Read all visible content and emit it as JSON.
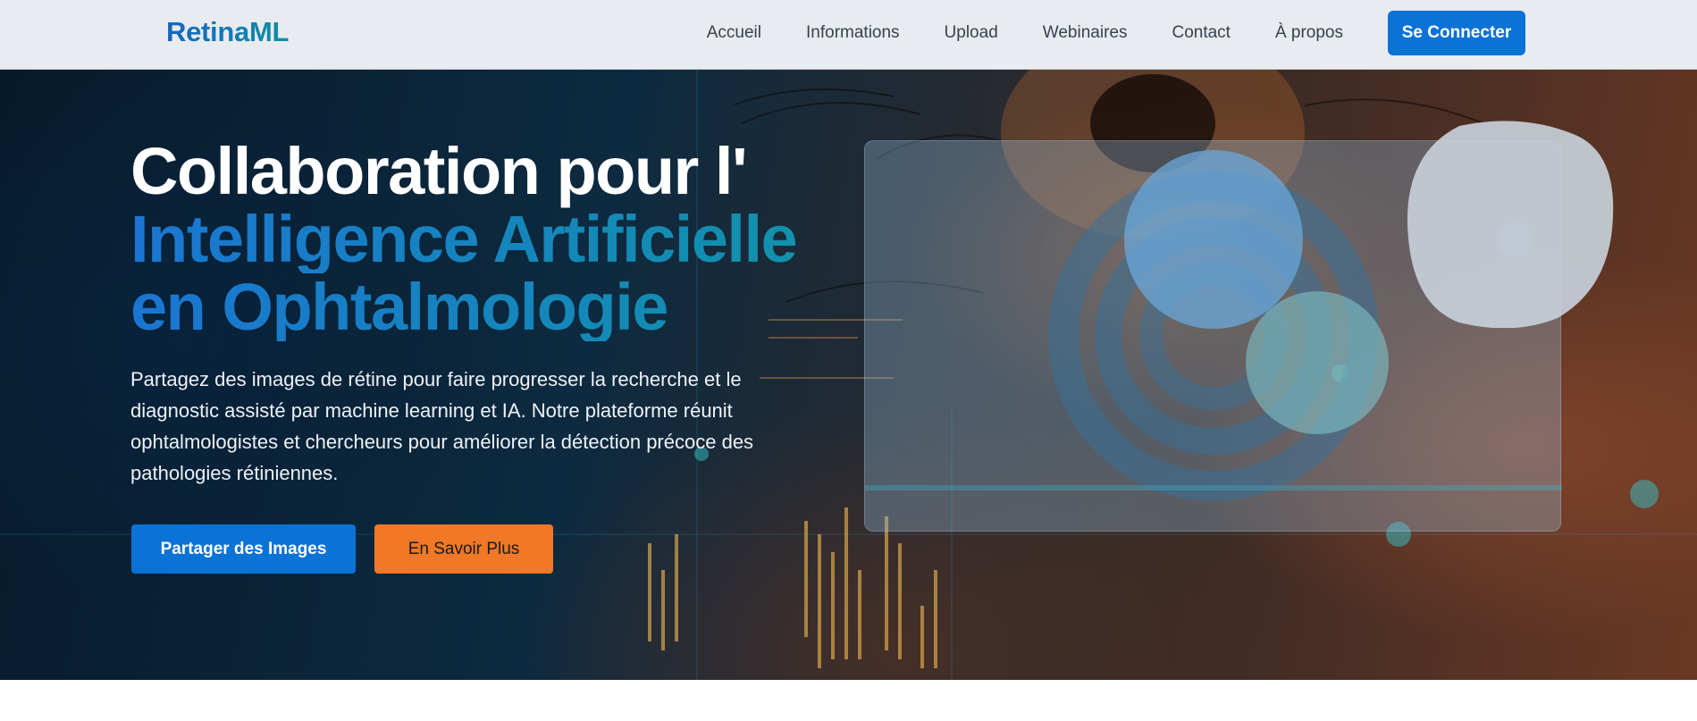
{
  "navbar": {
    "brand": "RetinaML",
    "links": [
      "Accueil",
      "Informations",
      "Upload",
      "Webinaires",
      "Contact",
      "À propos"
    ],
    "login_label": "Se Connecter"
  },
  "hero": {
    "title_line1": "Collaboration pour l'",
    "title_line2": "Intelligence Artificielle",
    "title_line3": "en Ophtalmologie",
    "description": "Partagez des images de rétine pour faire progresser la recherche et le diagnostic assisté par machine learning et IA. Notre plateforme réunit ophtalmologistes et chercheurs pour améliorer la détection précoce des pathologies rétiniennes.",
    "primary_button": "Partager des Images",
    "secondary_button": "En Savoir Plus"
  },
  "colors": {
    "primary": "#0b72d6",
    "accent_orange": "#f07826",
    "accent_teal": "#1194a8"
  }
}
